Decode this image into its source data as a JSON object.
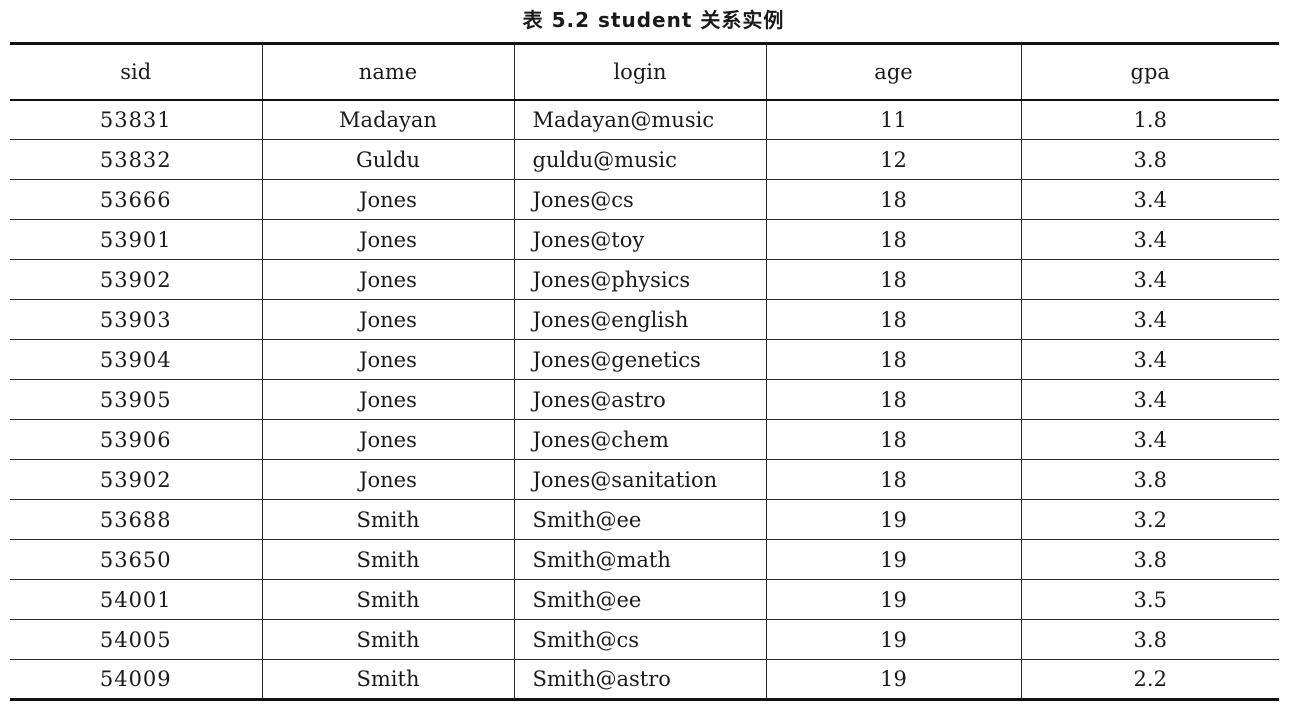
{
  "caption": {
    "label": "表",
    "number": "5.2",
    "title": "student 关系实例"
  },
  "table": {
    "headers": [
      "sid",
      "name",
      "login",
      "age",
      "gpa"
    ],
    "rows": [
      [
        "53831",
        "Madayan",
        "Madayan@music",
        "11",
        "1.8"
      ],
      [
        "53832",
        "Guldu",
        "guldu@music",
        "12",
        "3.8"
      ],
      [
        "53666",
        "Jones",
        "Jones@cs",
        "18",
        "3.4"
      ],
      [
        "53901",
        "Jones",
        "Jones@toy",
        "18",
        "3.4"
      ],
      [
        "53902",
        "Jones",
        "Jones@physics",
        "18",
        "3.4"
      ],
      [
        "53903",
        "Jones",
        "Jones@english",
        "18",
        "3.4"
      ],
      [
        "53904",
        "Jones",
        "Jones@genetics",
        "18",
        "3.4"
      ],
      [
        "53905",
        "Jones",
        "Jones@astro",
        "18",
        "3.4"
      ],
      [
        "53906",
        "Jones",
        "Jones@chem",
        "18",
        "3.4"
      ],
      [
        "53902",
        "Jones",
        "Jones@sanitation",
        "18",
        "3.8"
      ],
      [
        "53688",
        "Smith",
        "Smith@ee",
        "19",
        "3.2"
      ],
      [
        "53650",
        "Smith",
        "Smith@math",
        "19",
        "3.8"
      ],
      [
        "54001",
        "Smith",
        "Smith@ee",
        "19",
        "3.5"
      ],
      [
        "54005",
        "Smith",
        "Smith@cs",
        "19",
        "3.8"
      ],
      [
        "54009",
        "Smith",
        "Smith@astro",
        "19",
        "2.2"
      ]
    ]
  }
}
